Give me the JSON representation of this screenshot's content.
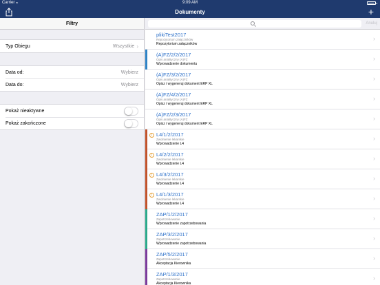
{
  "status": {
    "carrier": "Carrier",
    "time": "9:09 AM"
  },
  "nav": {
    "title": "Dokumenty",
    "add_label": "+"
  },
  "filters": {
    "header": "Filtry",
    "flow_type_label": "Typ Obiegu",
    "flow_type_value": "Wszystkie",
    "date_from_label": "Data od:",
    "date_from_placeholder": "Wybierz",
    "date_to_label": "Data do:",
    "date_to_placeholder": "Wybierz",
    "show_inactive_label": "Pokaż nieaktywne",
    "show_completed_label": "Pokaż zakończone",
    "show_inactive_on": false,
    "show_completed_on": false
  },
  "search": {
    "placeholder": "",
    "cancel_label": "Anuluj"
  },
  "documents": [
    {
      "code": "plikiTest2017",
      "type": "Repozytorium załączników",
      "step": "Repozytorium załączników",
      "color": "",
      "warning": false
    },
    {
      "code": "(A)FZ/2/2/2017",
      "type": "Opis analityczny (A)FZ",
      "step": "Wprowadzenie dokumentu",
      "color": "#2e82c4",
      "warning": false
    },
    {
      "code": "(A)FZ/3/2/2017",
      "type": "Opis analityczny (A)FZ",
      "step": "Opisz i wygeneruj dokument ERP XL",
      "color": "",
      "warning": false
    },
    {
      "code": "(A)FZ/4/2/2017",
      "type": "Opis analityczny (A)FZ",
      "step": "Opisz i wygeneruj dokument ERP XL",
      "color": "",
      "warning": false
    },
    {
      "code": "(A)FZ/2/3/2017",
      "type": "Opis analityczny (A)FZ",
      "step": "Opisz i wygeneruj dokument ERP XL",
      "color": "",
      "warning": false
    },
    {
      "code": "L4/1/2/2017",
      "type": "Zwolnienie lekarskie",
      "step": "Wprowadzenie L4",
      "color": "#c0522a",
      "warning": true
    },
    {
      "code": "L4/2/2/2017",
      "type": "Zwolnienie lekarskie",
      "step": "Wprowadzenie L4",
      "color": "#c0522a",
      "warning": true
    },
    {
      "code": "L4/3/2/2017",
      "type": "Zwolnienie lekarskie",
      "step": "Wprowadzenie L4",
      "color": "#c0522a",
      "warning": true
    },
    {
      "code": "L4/1/3/2017",
      "type": "Zwolnienie lekarskie",
      "step": "Wprowadzenie L4",
      "color": "#c0522a",
      "warning": true
    },
    {
      "code": "ZAP/1/2/2017",
      "type": "Zapotrzebowanie",
      "step": "Wprowadzenie zapotrzebowania",
      "color": "#2aa88a",
      "warning": false
    },
    {
      "code": "ZAP/3/2/2017",
      "type": "Zapotrzebowanie",
      "step": "Wprowadzenie zapotrzebowania",
      "color": "#2aa88a",
      "warning": false
    },
    {
      "code": "ZAP/5/2/2017",
      "type": "Zapotrzebowanie",
      "step": "Akceptacja Kierownika",
      "color": "#7a3a9a",
      "warning": false
    },
    {
      "code": "ZAP/1/3/2017",
      "type": "Zapotrzebowanie",
      "step": "Akceptacja Kierownika",
      "color": "#7a3a9a",
      "warning": false
    }
  ]
}
